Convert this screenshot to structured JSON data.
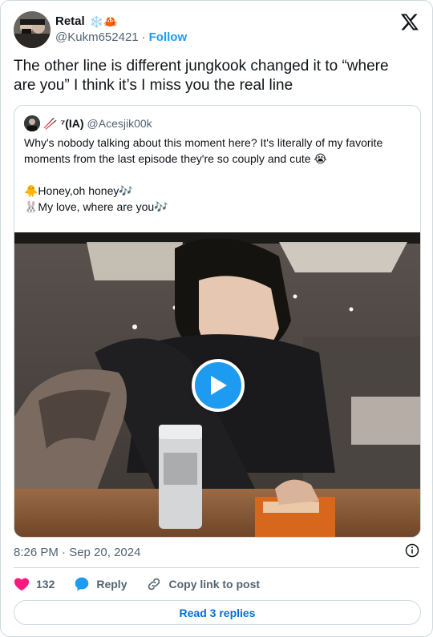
{
  "author": {
    "name": "Retal",
    "name_emojis": "❄️🦀",
    "handle": "@Kukm652421",
    "separator": "·",
    "follow_label": "Follow"
  },
  "tweet": {
    "text": "The other line is different jungkook changed it to “where are you” I think it’s I miss you the real line"
  },
  "quote": {
    "name_prefix": "🥢",
    "name": "⁷(IA)",
    "handle": "@Acesjik00k",
    "text_para1": "Why's nobody talking about this moment here? It's literally of my favorite moments from the last episode they're so couply and cute 😭",
    "text_line2": "🐥Honey,oh honey🎶",
    "text_line3": "🐰My love, where are you🎶"
  },
  "meta": {
    "timestamp": "8:26 PM · Sep 20, 2024"
  },
  "actions": {
    "like_count": "132",
    "reply_label": "Reply",
    "copy_label": "Copy link to post"
  },
  "read_replies_label": "Read 3 replies",
  "colors": {
    "accent": "#1d9bf0",
    "like": "#f91880",
    "link": "#006fd6",
    "muted": "#536471",
    "border": "#cfd9de"
  }
}
